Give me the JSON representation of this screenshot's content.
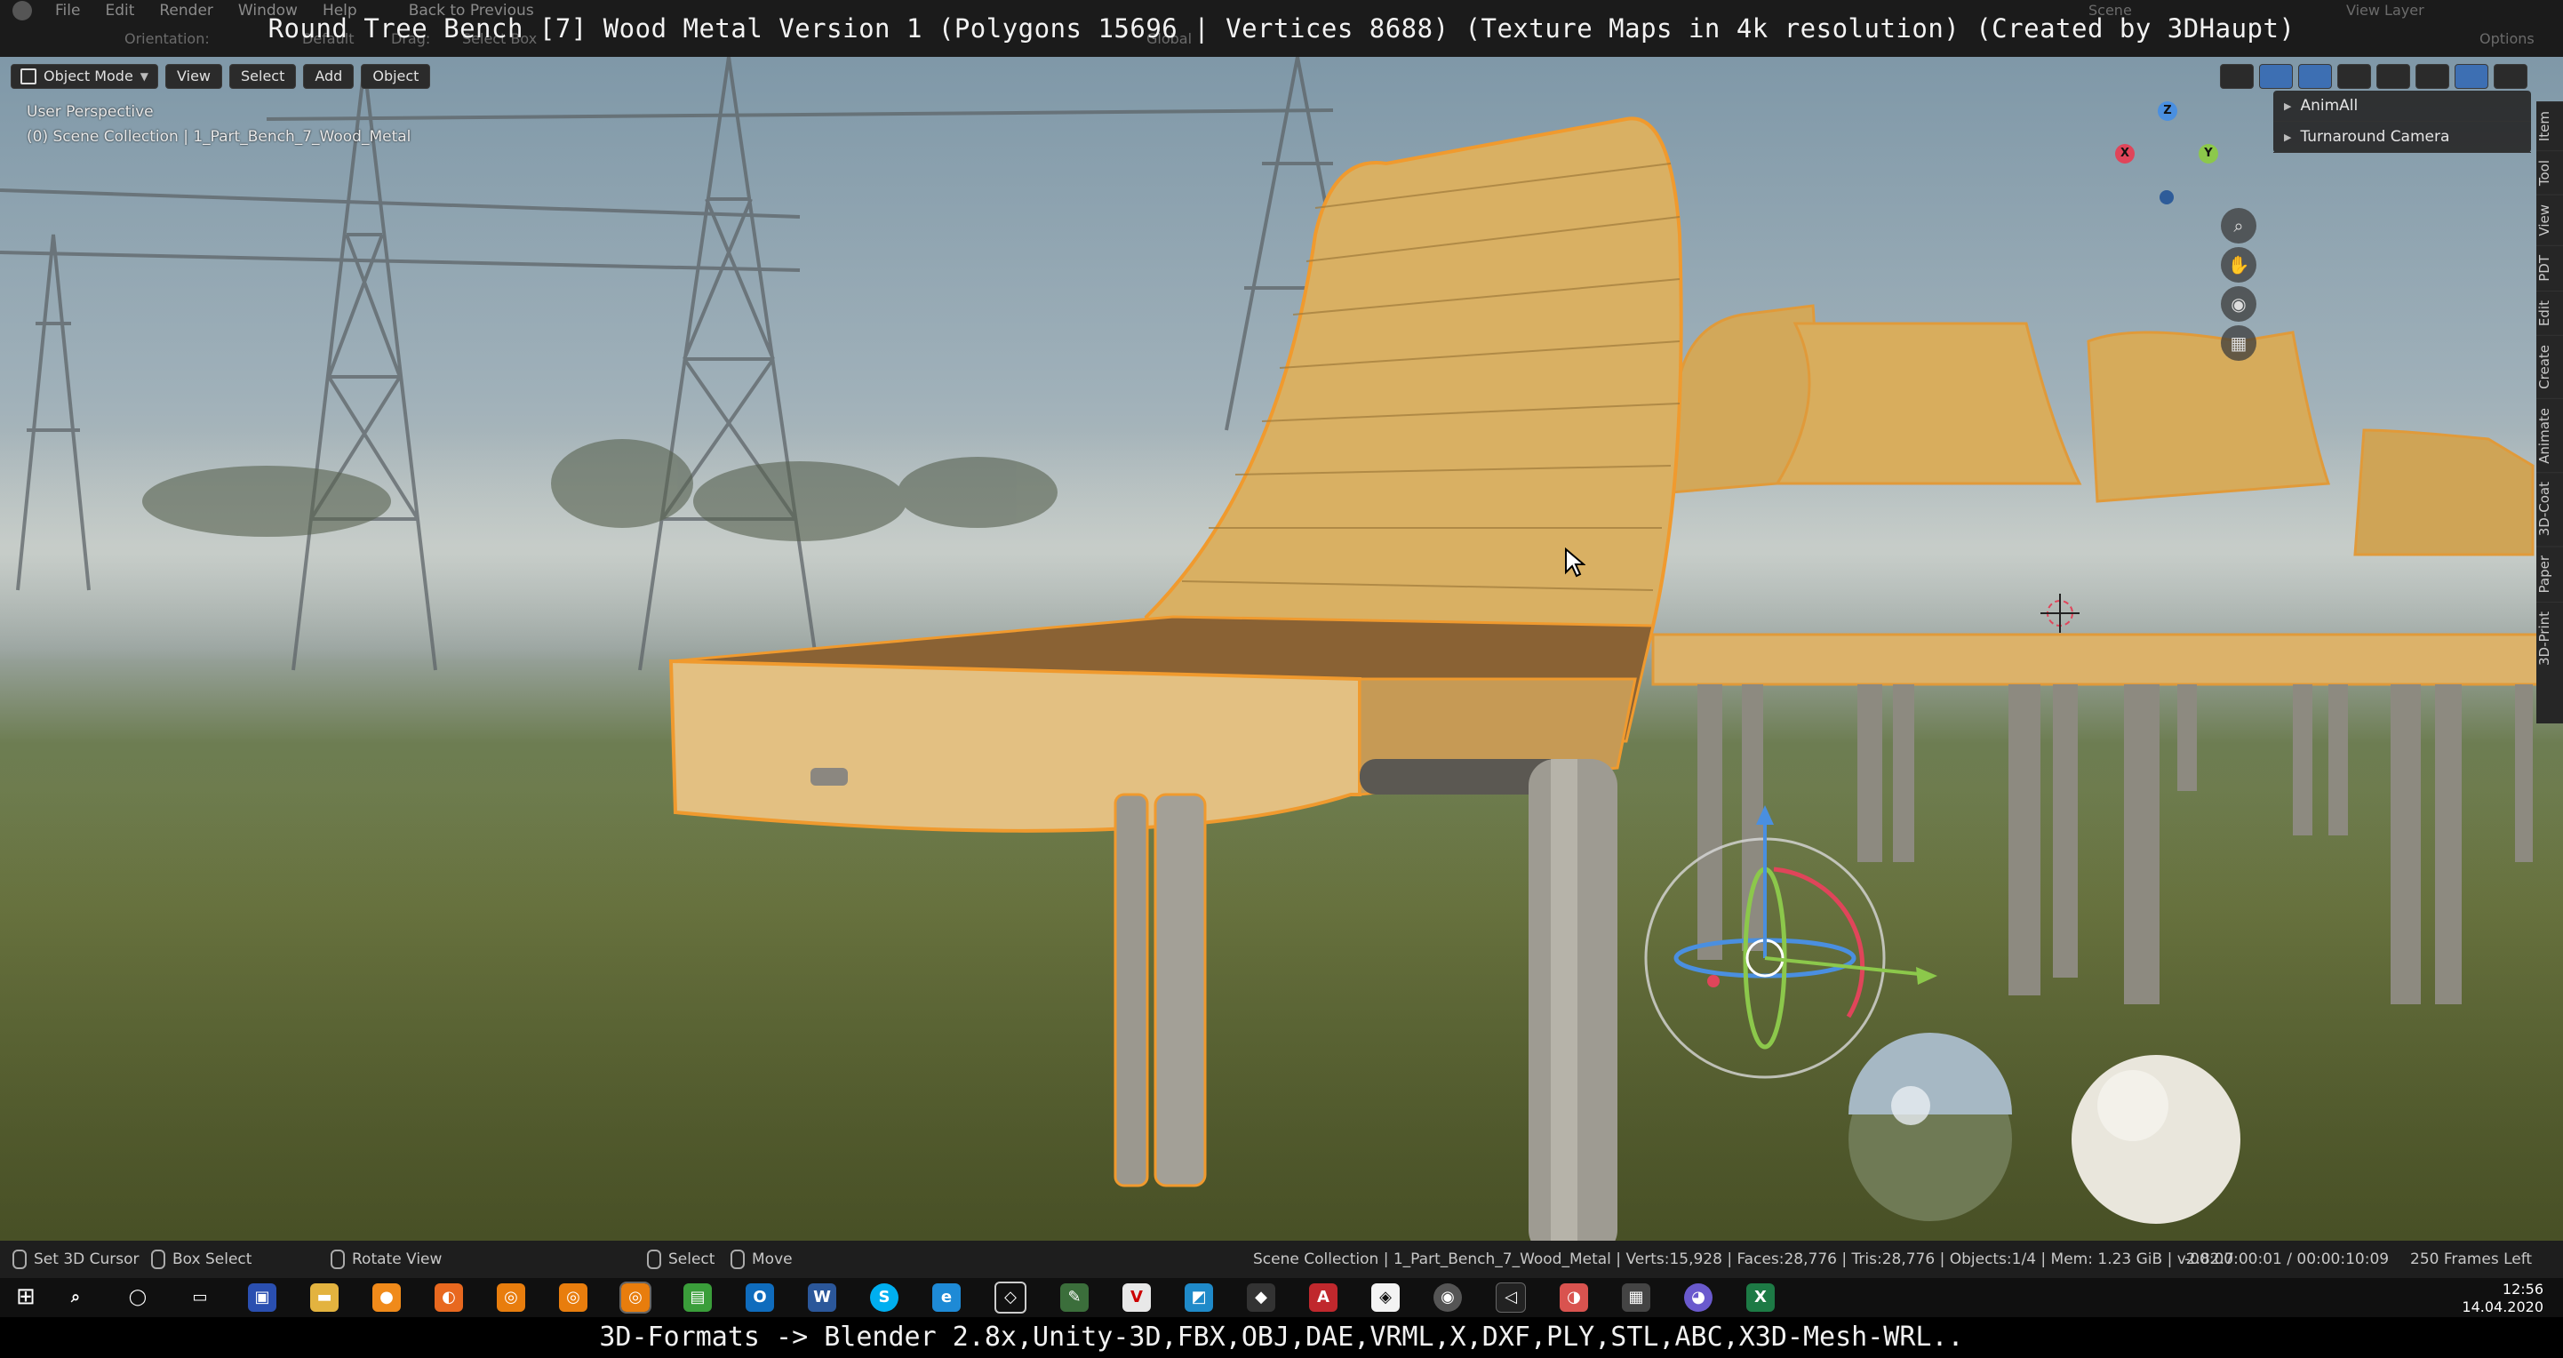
{
  "window": {
    "title_overlay": "Round Tree Bench [7] Wood Metal Version 1 (Polygons 15696 | Vertices 8688) (Texture Maps in 4k resolution) (Created by 3DHaupt)"
  },
  "menubar": {
    "items": [
      "File",
      "Edit",
      "Render",
      "Window",
      "Help"
    ],
    "back_to_previous": "Back to Previous",
    "scene": "Scene",
    "view_layer": "View Layer"
  },
  "tool_header": {
    "orientation_label": "Orientation:",
    "orientation_value": "Default",
    "drag_label": "Drag:",
    "drag_value": "Select Box",
    "transform_space": "Global",
    "options": "Options"
  },
  "viewport_header": {
    "mode": "Object Mode",
    "menus": [
      "View",
      "Select",
      "Add",
      "Object"
    ]
  },
  "viewport": {
    "perspective": "User Perspective",
    "collection": "(0) Scene Collection | 1_Part_Bench_7_Wood_Metal"
  },
  "npanel": {
    "rows": [
      "AnimAll",
      "Turnaround Camera"
    ],
    "tabs": [
      "Item",
      "Tool",
      "View",
      "PDT",
      "Edit",
      "Create",
      "Animate",
      "3D-Coat",
      "Paper",
      "3D-Print"
    ]
  },
  "gizmo": {
    "axes": [
      "Z",
      "X",
      "Y"
    ]
  },
  "statusbar": {
    "set_cursor": "Set 3D Cursor",
    "box_select": "Box Select",
    "rotate_view": "Rotate View",
    "select": "Select",
    "move": "Move",
    "stats": "Scene Collection | 1_Part_Bench_7_Wood_Metal | Verts:15,928 | Faces:28,776 | Tris:28,776 | Objects:1/4 | Mem: 1.23 GiB | v2.82.7",
    "time": "-00:00:00:01 / 00:00:10:09",
    "frames": "250 Frames Left"
  },
  "taskbar": {
    "time": "12:56",
    "date": "14.04.2020"
  },
  "caption": "3D-Formats -> Blender 2.8x,Unity-3D,FBX,OBJ,DAE,VRML,X,DXF,PLY,STL,ABC,X3D-Mesh-WRL..",
  "colors": {
    "accent_blue": "#3d6fb3",
    "selection_outline": "#f09a2e",
    "axis_x": "#e0455a",
    "axis_y": "#8cc84b",
    "axis_z": "#4a8fe0"
  }
}
